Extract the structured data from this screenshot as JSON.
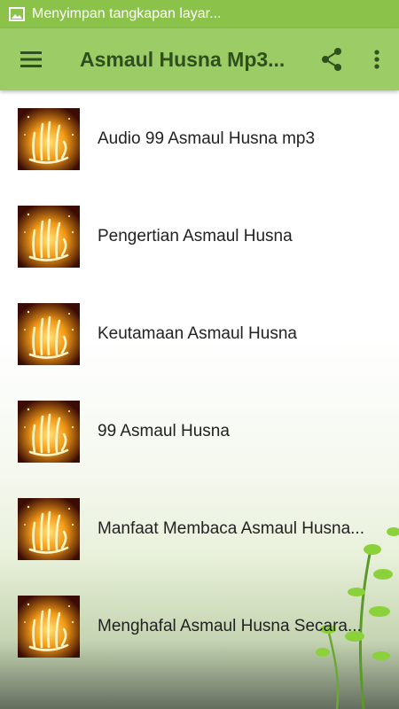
{
  "status_bar": {
    "notification_text": "Menyimpan tangkapan layar...",
    "icon": "image-icon"
  },
  "app_bar": {
    "title": "Asmaul Husna Mp3...",
    "menu_icon": "hamburger-menu-icon",
    "share_icon": "share-icon",
    "more_icon": "more-vertical-icon"
  },
  "list": {
    "items": [
      {
        "label": "Audio 99 Asmaul Husna mp3",
        "icon": "allah-calligraphy-thumbnail"
      },
      {
        "label": "Pengertian Asmaul Husna",
        "icon": "allah-calligraphy-thumbnail"
      },
      {
        "label": "Keutamaan Asmaul Husna",
        "icon": "allah-calligraphy-thumbnail"
      },
      {
        "label": "99 Asmaul Husna",
        "icon": "allah-calligraphy-thumbnail"
      },
      {
        "label": "Manfaat Membaca Asmaul Husna...",
        "icon": "allah-calligraphy-thumbnail"
      },
      {
        "label": "Menghafal Asmaul Husna Secara...",
        "icon": "allah-calligraphy-thumbnail"
      }
    ]
  },
  "colors": {
    "status_bar": "#8bc34a",
    "app_bar": "#9ccc65",
    "title_text": "#2f4f1f"
  }
}
